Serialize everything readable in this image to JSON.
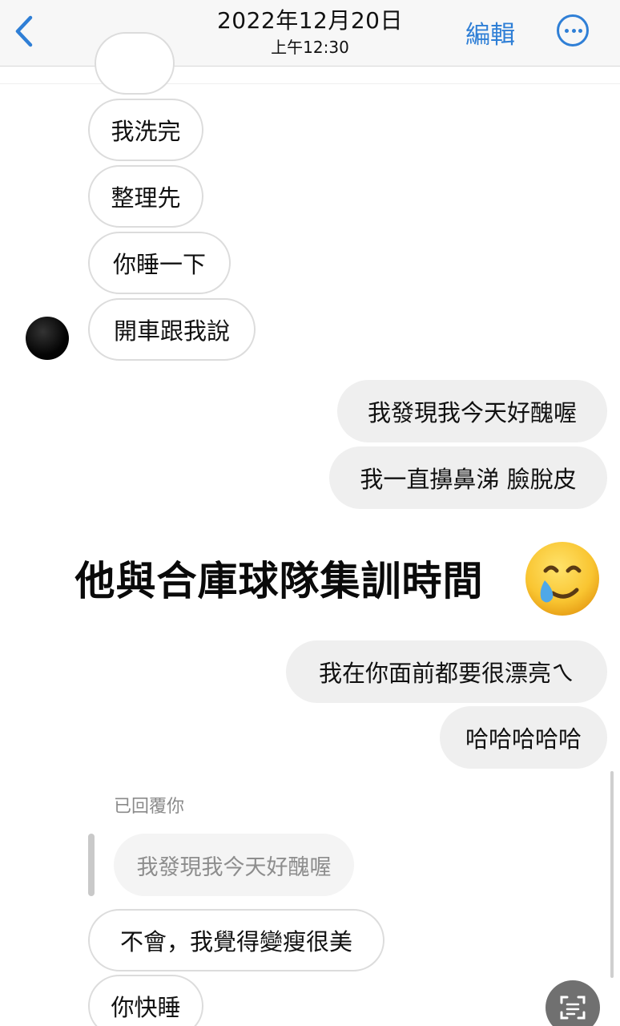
{
  "header": {
    "date": "2022年12月20日",
    "time": "上午12:30",
    "edit_label": "編輯",
    "back_icon": "chevron-left-icon",
    "more_icon": "ellipsis-circle-icon",
    "accent_color": "#2f7fd6"
  },
  "messages": {
    "received_top": [
      "我洗完",
      "整理先",
      "你睡一下",
      "開車跟我說"
    ],
    "sent_mid": [
      "我發現我今天好醜喔",
      "我一直擤鼻涕 臉脫皮"
    ],
    "sent_lower": [
      "我在你面前都要很漂亮ㄟ",
      "哈哈哈哈哈"
    ],
    "reply_label": "已回覆你",
    "quoted_text": "我發現我今天好醜喔",
    "received_bottom": [
      "不會，我覺得變瘦很美",
      "你快睡"
    ]
  },
  "caption": {
    "text": "他與合庫球隊集訓時間",
    "emoji": "smiling-face-with-tear-emoji"
  },
  "scan_icon": "text-scan-icon"
}
